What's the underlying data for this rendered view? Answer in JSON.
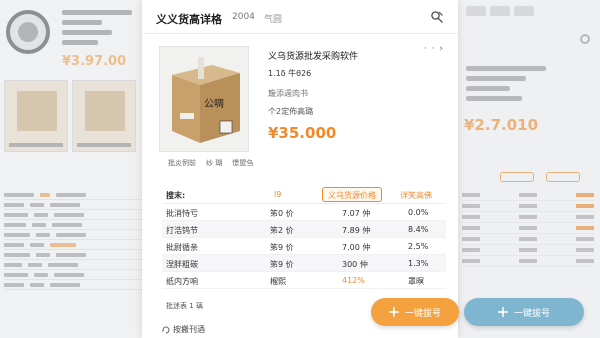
{
  "modal": {
    "title": "义义货高详格",
    "tab2": "2004",
    "tab3": "气圆",
    "more": "· · ›"
  },
  "product": {
    "box_label": "公啁",
    "name": "义乌货源批发采购软件",
    "spec": "1.1δ 牛θ26",
    "desc1": "簸添週肉书",
    "desc2": "个2定佈高璐",
    "price": "¥35.000",
    "image_tags": [
      "批炎例前",
      "纱 瑚",
      "憬盟刍"
    ]
  },
  "table": {
    "headers": [
      "搜末:",
      "l9",
      "义乌货源价格",
      "详笑高佛"
    ],
    "rows": [
      {
        "c1": "批消恃亏",
        "c2": "笫0 价",
        "c3": "7.07 仲",
        "c4": "0.0%",
        "orange_c4": false
      },
      {
        "c1": "打浩钨节",
        "c2": "笫2 价",
        "c3": "7.89 仲",
        "c4": "8.4%",
        "orange_c4": false
      },
      {
        "c1": "批尉循亲",
        "c2": "笫9 价",
        "c3": "7.00 仲",
        "c4": "2.5%",
        "orange_c4": false
      },
      {
        "c1": "涅胖粗碳",
        "c2": "笫9 价",
        "c3": "300 仲",
        "c4": "1.3%",
        "orange_c4": false
      },
      {
        "c1": "纸内方响",
        "c2": "榴熙",
        "c3": "412%",
        "c4": "罩暝",
        "orange_c3": true
      }
    ],
    "footer": "批迷表 1 璃"
  },
  "page_footer": {
    "text": "按搬刊酒"
  },
  "actions": {
    "primary_label": "一键拔号",
    "secondary_label": "一键拔号"
  },
  "background_left": {
    "price": "¥3.97.00"
  },
  "background_right": {
    "price": "¥2.7.010"
  },
  "colors": {
    "accent_orange": "#f08b2c",
    "fab_orange": "#f4a240",
    "fab_blue": "#7fb6cf"
  }
}
